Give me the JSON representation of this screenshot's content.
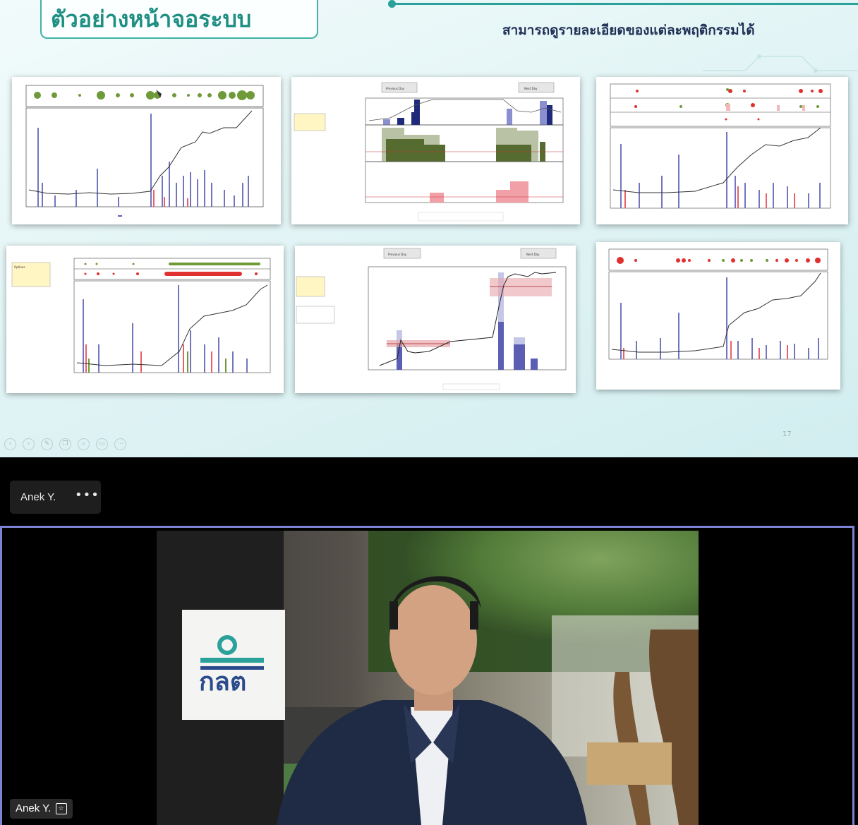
{
  "slide": {
    "title": "ตัวอย่างหน้าจอระบบ",
    "subtitle": "สามารถดูรายละเอียดของแต่ละพฤติกรรมได้",
    "page_number": "17",
    "panels": [
      {
        "id": "p1",
        "kind": "bubble-volume-price"
      },
      {
        "id": "p2",
        "kind": "intraday-detail",
        "buttons": [
          "Previous Day",
          "Next Day"
        ]
      },
      {
        "id": "p3",
        "kind": "multi-bubble-volume-price"
      },
      {
        "id": "p4",
        "kind": "options-bubble-volume-price",
        "options_label": "Options"
      },
      {
        "id": "p5",
        "kind": "intraday-support",
        "buttons": [
          "Previous Day",
          "Next Day"
        ]
      },
      {
        "id": "p6",
        "kind": "bubble-volume-price-red-green"
      }
    ],
    "controls": [
      "prev-icon",
      "play-icon",
      "pen-icon",
      "copy-icon",
      "zoom-icon",
      "subtitle-icon",
      "more-icon"
    ]
  },
  "colors": {
    "accent": "#2aa19a",
    "bar_blue": "#5b5fb3",
    "bar_red": "#e8606b",
    "bubble_green": "#6f9a3a",
    "bubble_red": "#e03030",
    "tile_border": "#7c83d4"
  },
  "meeting": {
    "speaker_chip_name": "Anek Y.",
    "more_label": "•••",
    "tile_name": "Anek Y.",
    "tile_icon": "pin-icon",
    "logo_text": "กลต"
  }
}
